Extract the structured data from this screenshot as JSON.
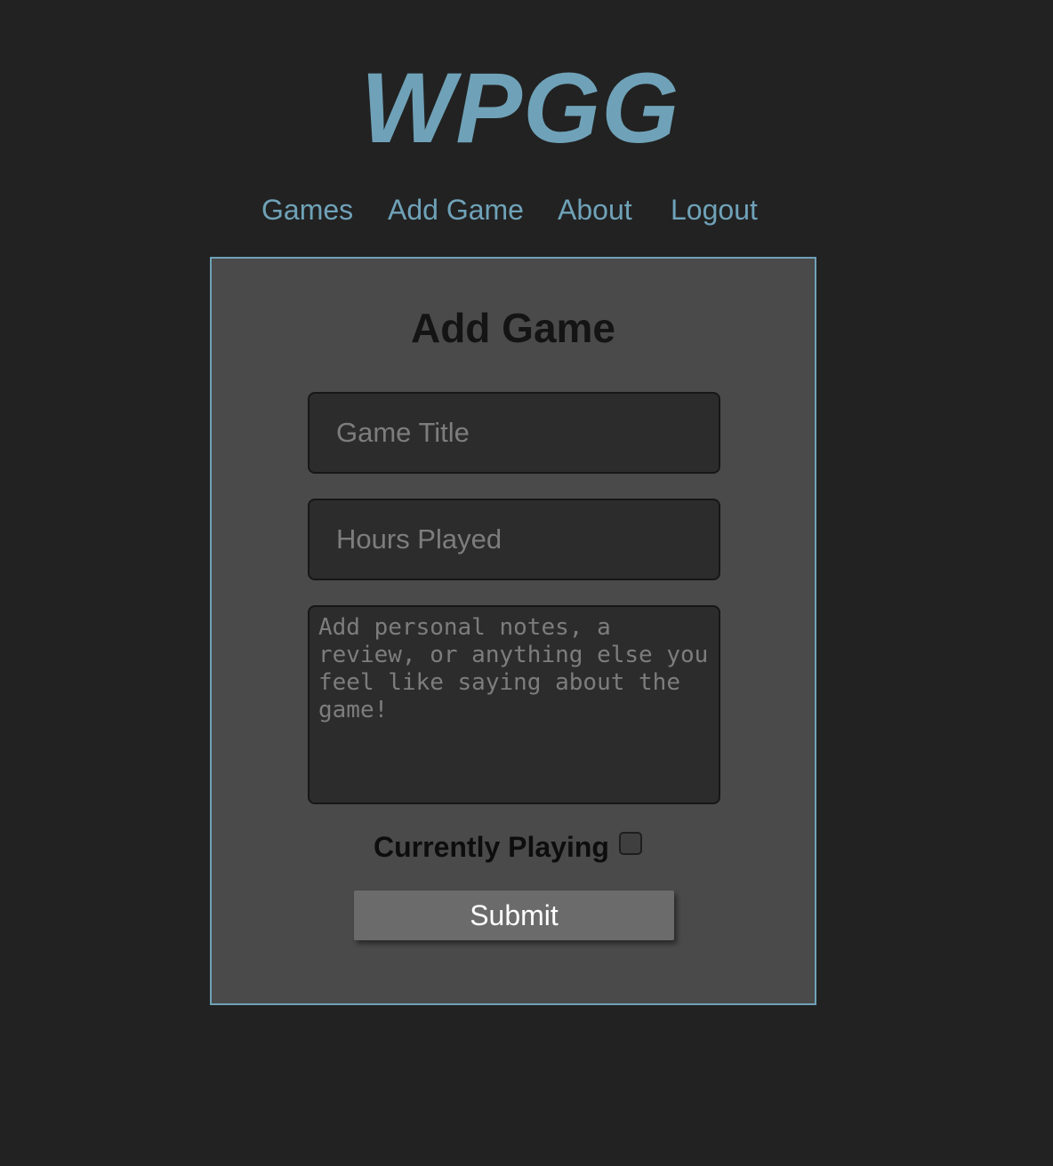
{
  "header": {
    "logo_text": "WPGG"
  },
  "nav": {
    "items": [
      {
        "label": "Games"
      },
      {
        "label": "Add Game"
      },
      {
        "label": "About"
      },
      {
        "label": "Logout"
      }
    ]
  },
  "form": {
    "title": "Add Game",
    "game_title": {
      "value": "",
      "placeholder": "Game Title"
    },
    "hours_played": {
      "value": "",
      "placeholder": "Hours Played"
    },
    "notes": {
      "value": "",
      "placeholder": "Add personal notes, a review, or anything else you feel like saying about the game!"
    },
    "currently_playing": {
      "label": "Currently Playing",
      "checked": false
    },
    "submit_label": "Submit"
  },
  "colors": {
    "background": "#222222",
    "accent": "#6fa2b8",
    "card": "#4a4a4a",
    "input": "#2c2c2c",
    "button": "#6b6b6b"
  }
}
